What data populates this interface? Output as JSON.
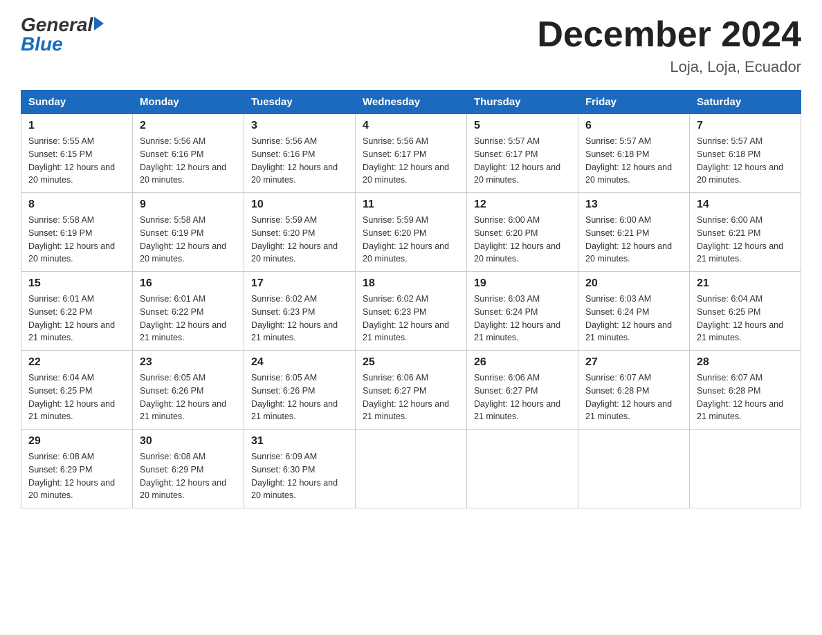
{
  "header": {
    "logo": {
      "general": "General",
      "blue": "Blue"
    },
    "title": "December 2024",
    "location": "Loja, Loja, Ecuador"
  },
  "days_of_week": [
    "Sunday",
    "Monday",
    "Tuesday",
    "Wednesday",
    "Thursday",
    "Friday",
    "Saturday"
  ],
  "weeks": [
    [
      {
        "day": "1",
        "sunrise": "5:55 AM",
        "sunset": "6:15 PM",
        "daylight": "12 hours and 20 minutes."
      },
      {
        "day": "2",
        "sunrise": "5:56 AM",
        "sunset": "6:16 PM",
        "daylight": "12 hours and 20 minutes."
      },
      {
        "day": "3",
        "sunrise": "5:56 AM",
        "sunset": "6:16 PM",
        "daylight": "12 hours and 20 minutes."
      },
      {
        "day": "4",
        "sunrise": "5:56 AM",
        "sunset": "6:17 PM",
        "daylight": "12 hours and 20 minutes."
      },
      {
        "day": "5",
        "sunrise": "5:57 AM",
        "sunset": "6:17 PM",
        "daylight": "12 hours and 20 minutes."
      },
      {
        "day": "6",
        "sunrise": "5:57 AM",
        "sunset": "6:18 PM",
        "daylight": "12 hours and 20 minutes."
      },
      {
        "day": "7",
        "sunrise": "5:57 AM",
        "sunset": "6:18 PM",
        "daylight": "12 hours and 20 minutes."
      }
    ],
    [
      {
        "day": "8",
        "sunrise": "5:58 AM",
        "sunset": "6:19 PM",
        "daylight": "12 hours and 20 minutes."
      },
      {
        "day": "9",
        "sunrise": "5:58 AM",
        "sunset": "6:19 PM",
        "daylight": "12 hours and 20 minutes."
      },
      {
        "day": "10",
        "sunrise": "5:59 AM",
        "sunset": "6:20 PM",
        "daylight": "12 hours and 20 minutes."
      },
      {
        "day": "11",
        "sunrise": "5:59 AM",
        "sunset": "6:20 PM",
        "daylight": "12 hours and 20 minutes."
      },
      {
        "day": "12",
        "sunrise": "6:00 AM",
        "sunset": "6:20 PM",
        "daylight": "12 hours and 20 minutes."
      },
      {
        "day": "13",
        "sunrise": "6:00 AM",
        "sunset": "6:21 PM",
        "daylight": "12 hours and 20 minutes."
      },
      {
        "day": "14",
        "sunrise": "6:00 AM",
        "sunset": "6:21 PM",
        "daylight": "12 hours and 21 minutes."
      }
    ],
    [
      {
        "day": "15",
        "sunrise": "6:01 AM",
        "sunset": "6:22 PM",
        "daylight": "12 hours and 21 minutes."
      },
      {
        "day": "16",
        "sunrise": "6:01 AM",
        "sunset": "6:22 PM",
        "daylight": "12 hours and 21 minutes."
      },
      {
        "day": "17",
        "sunrise": "6:02 AM",
        "sunset": "6:23 PM",
        "daylight": "12 hours and 21 minutes."
      },
      {
        "day": "18",
        "sunrise": "6:02 AM",
        "sunset": "6:23 PM",
        "daylight": "12 hours and 21 minutes."
      },
      {
        "day": "19",
        "sunrise": "6:03 AM",
        "sunset": "6:24 PM",
        "daylight": "12 hours and 21 minutes."
      },
      {
        "day": "20",
        "sunrise": "6:03 AM",
        "sunset": "6:24 PM",
        "daylight": "12 hours and 21 minutes."
      },
      {
        "day": "21",
        "sunrise": "6:04 AM",
        "sunset": "6:25 PM",
        "daylight": "12 hours and 21 minutes."
      }
    ],
    [
      {
        "day": "22",
        "sunrise": "6:04 AM",
        "sunset": "6:25 PM",
        "daylight": "12 hours and 21 minutes."
      },
      {
        "day": "23",
        "sunrise": "6:05 AM",
        "sunset": "6:26 PM",
        "daylight": "12 hours and 21 minutes."
      },
      {
        "day": "24",
        "sunrise": "6:05 AM",
        "sunset": "6:26 PM",
        "daylight": "12 hours and 21 minutes."
      },
      {
        "day": "25",
        "sunrise": "6:06 AM",
        "sunset": "6:27 PM",
        "daylight": "12 hours and 21 minutes."
      },
      {
        "day": "26",
        "sunrise": "6:06 AM",
        "sunset": "6:27 PM",
        "daylight": "12 hours and 21 minutes."
      },
      {
        "day": "27",
        "sunrise": "6:07 AM",
        "sunset": "6:28 PM",
        "daylight": "12 hours and 21 minutes."
      },
      {
        "day": "28",
        "sunrise": "6:07 AM",
        "sunset": "6:28 PM",
        "daylight": "12 hours and 21 minutes."
      }
    ],
    [
      {
        "day": "29",
        "sunrise": "6:08 AM",
        "sunset": "6:29 PM",
        "daylight": "12 hours and 20 minutes."
      },
      {
        "day": "30",
        "sunrise": "6:08 AM",
        "sunset": "6:29 PM",
        "daylight": "12 hours and 20 minutes."
      },
      {
        "day": "31",
        "sunrise": "6:09 AM",
        "sunset": "6:30 PM",
        "daylight": "12 hours and 20 minutes."
      },
      null,
      null,
      null,
      null
    ]
  ],
  "labels": {
    "sunrise_prefix": "Sunrise: ",
    "sunset_prefix": "Sunset: ",
    "daylight_prefix": "Daylight: "
  }
}
